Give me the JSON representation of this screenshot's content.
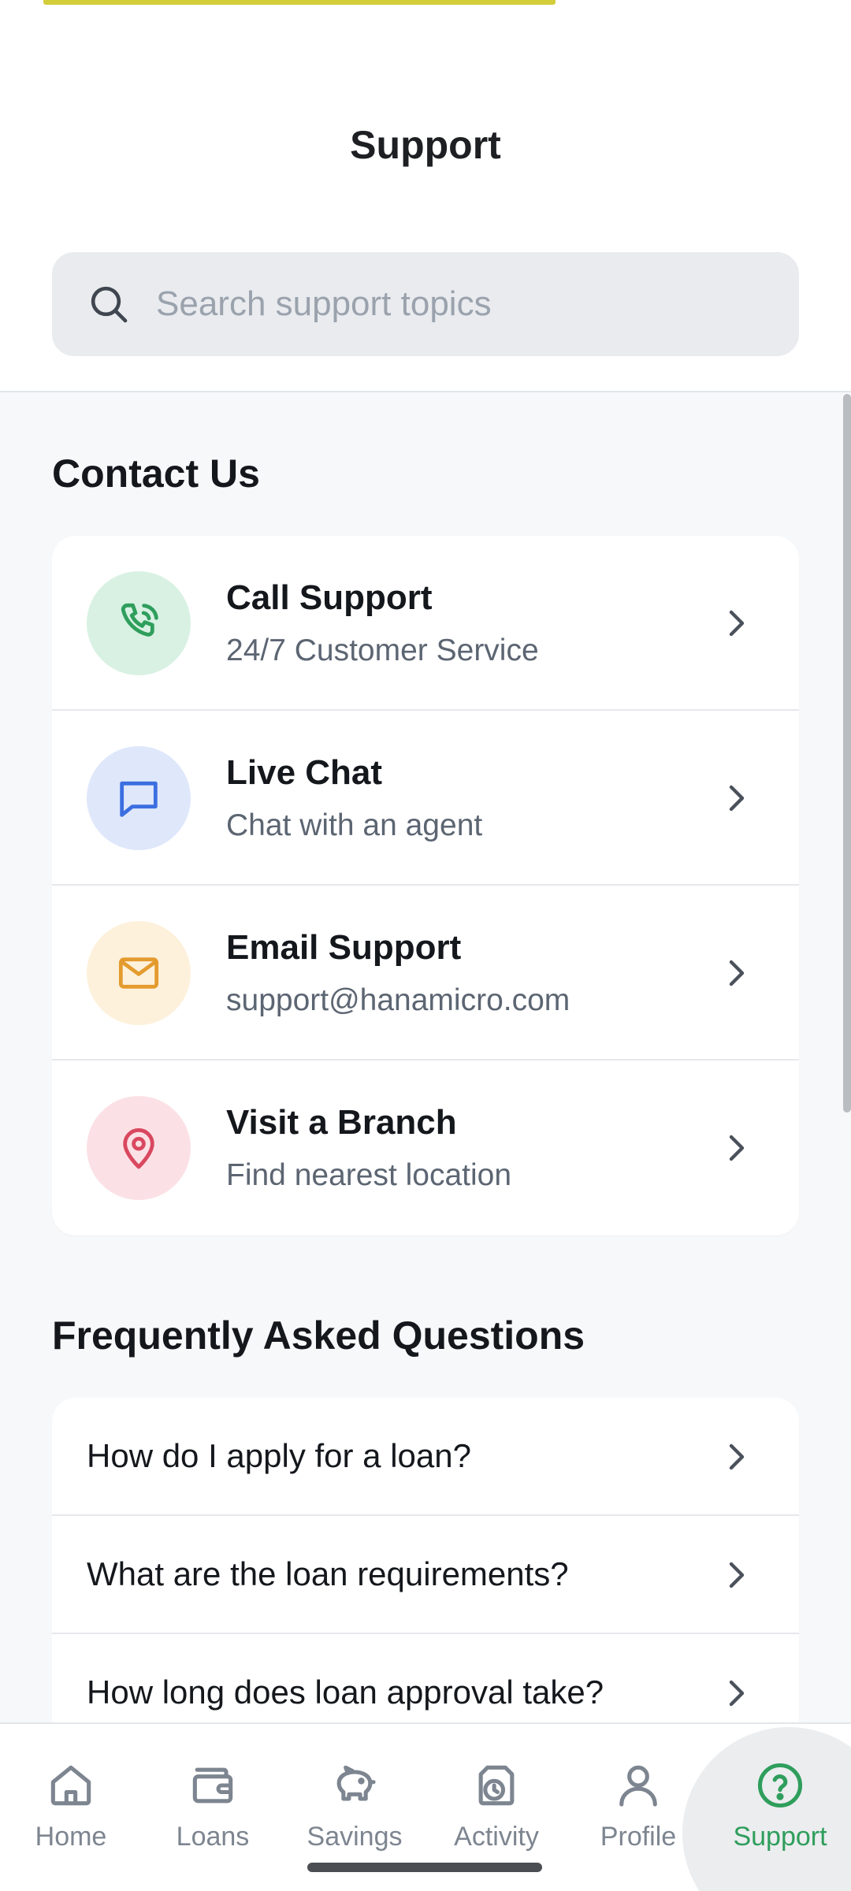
{
  "header": {
    "title": "Support",
    "search_placeholder": "Search support topics",
    "search_value": ""
  },
  "contact": {
    "section_title": "Contact Us",
    "items": [
      {
        "title": "Call Support",
        "subtitle": "24/7 Customer Service",
        "icon": "phone-icon",
        "icon_color": "#2f9e5c",
        "badge_color": "#d8f1e3"
      },
      {
        "title": "Live Chat",
        "subtitle": "Chat with an agent",
        "icon": "chat-icon",
        "icon_color": "#3b6fe0",
        "badge_color": "#dfe7fb"
      },
      {
        "title": "Email Support",
        "subtitle": "support@hanamicro.com",
        "icon": "mail-icon",
        "icon_color": "#e49b2e",
        "badge_color": "#fdf1dc"
      },
      {
        "title": "Visit a Branch",
        "subtitle": "Find nearest location",
        "icon": "location-pin-icon",
        "icon_color": "#d9485f",
        "badge_color": "#fbe1e5"
      }
    ]
  },
  "faq": {
    "section_title": "Frequently Asked Questions",
    "items": [
      {
        "question": "How do I apply for a loan?"
      },
      {
        "question": "What are the loan requirements?"
      },
      {
        "question": "How long does loan approval take?"
      }
    ]
  },
  "bottom_nav": {
    "items": [
      {
        "label": "Home",
        "icon": "home-icon"
      },
      {
        "label": "Loans",
        "icon": "wallet-icon"
      },
      {
        "label": "Savings",
        "icon": "piggy-bank-icon"
      },
      {
        "label": "Activity",
        "icon": "activity-icon"
      },
      {
        "label": "Profile",
        "icon": "profile-icon"
      },
      {
        "label": "Support",
        "icon": "help-icon",
        "active": true
      }
    ],
    "active_color": "#2f9e5c",
    "inactive_color": "#7d8590"
  }
}
